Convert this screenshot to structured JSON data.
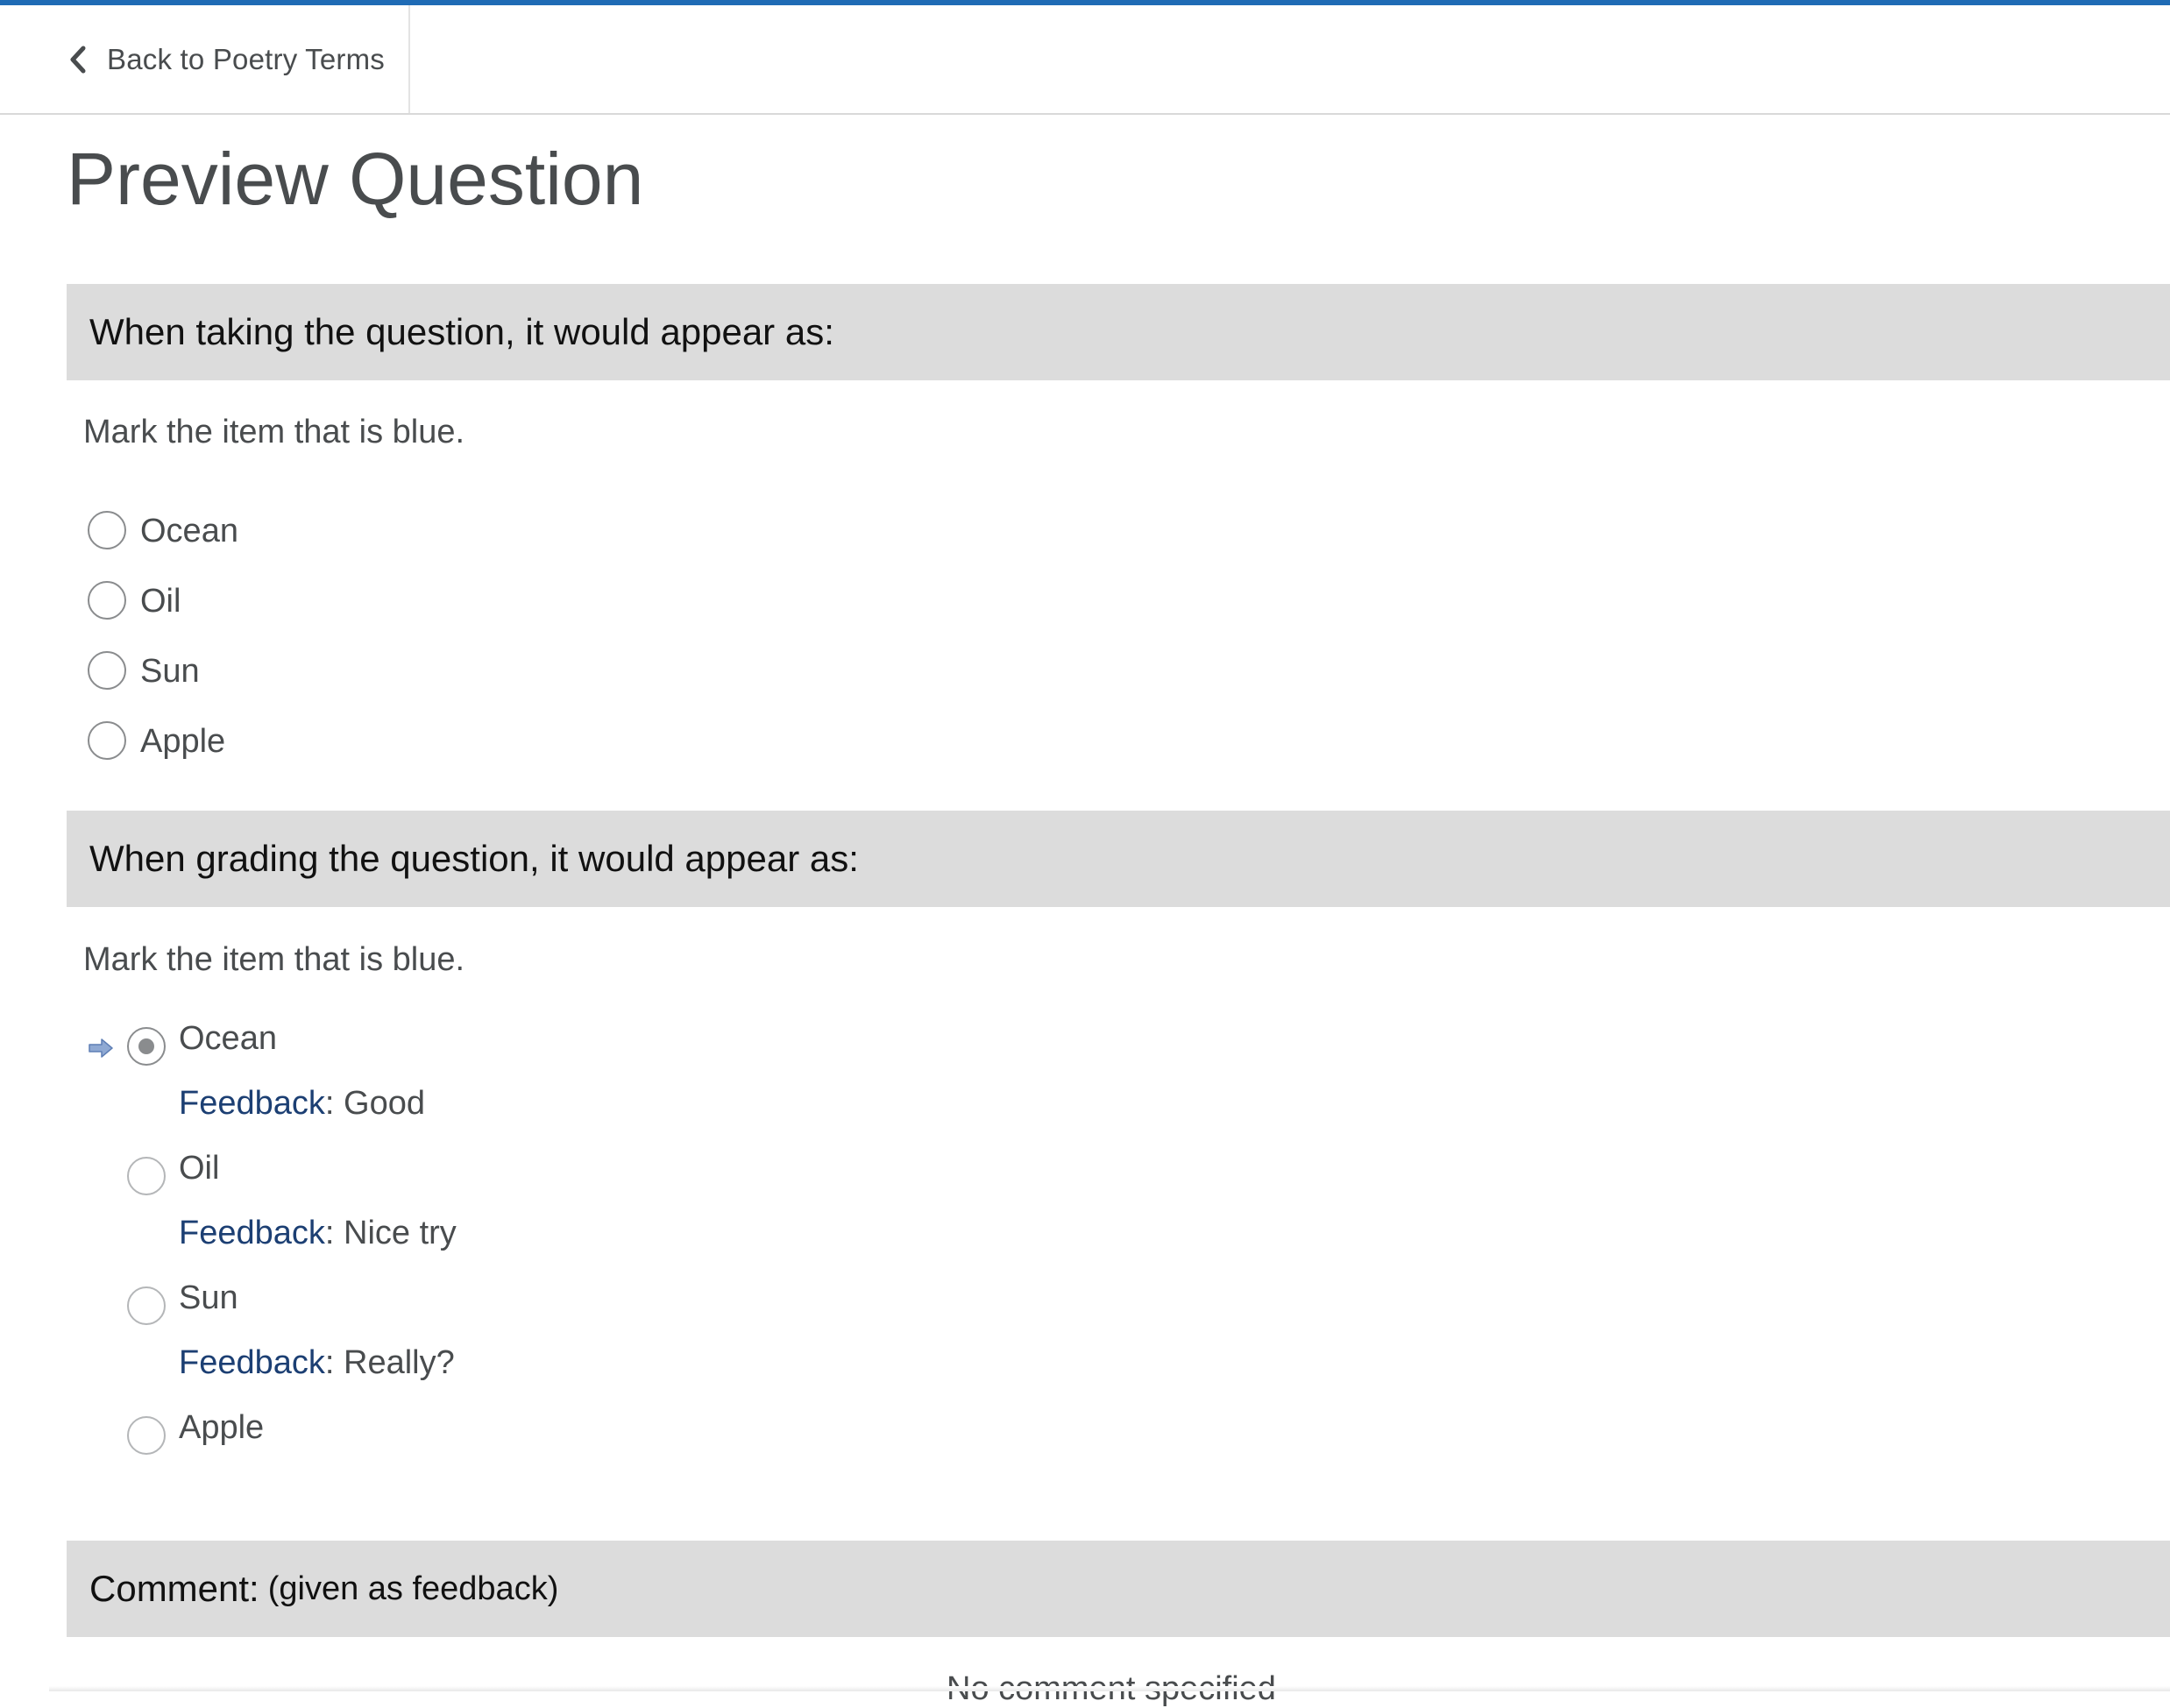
{
  "nav": {
    "back_label": "Back to Poetry Terms"
  },
  "page": {
    "title": "Preview Question"
  },
  "taking": {
    "heading": "When taking the question, it would appear as:",
    "prompt": "Mark the item that is blue.",
    "options": [
      "Ocean",
      "Oil",
      "Sun",
      "Apple"
    ]
  },
  "grading": {
    "heading": "When grading the question, it would appear as:",
    "prompt": "Mark the item that is blue.",
    "feedback_key": "Feedback",
    "options": [
      {
        "label": "Ocean",
        "selected": true,
        "feedback": "Good"
      },
      {
        "label": "Oil",
        "selected": false,
        "feedback": "Nice try"
      },
      {
        "label": "Sun",
        "selected": false,
        "feedback": "Really?"
      },
      {
        "label": "Apple",
        "selected": false,
        "feedback": ""
      }
    ]
  },
  "comment": {
    "heading": "Comment:",
    "sub": "(given as feedback)",
    "empty_text": "No comment specified"
  },
  "colors": {
    "accent": "#1f6bb5",
    "section_bg": "#dcdcdc",
    "feedback_key": "#1c3f73",
    "text": "#494c4e"
  },
  "icons": {
    "back": "chevron-left-icon",
    "selected_indicator": "arrow-right-icon"
  }
}
